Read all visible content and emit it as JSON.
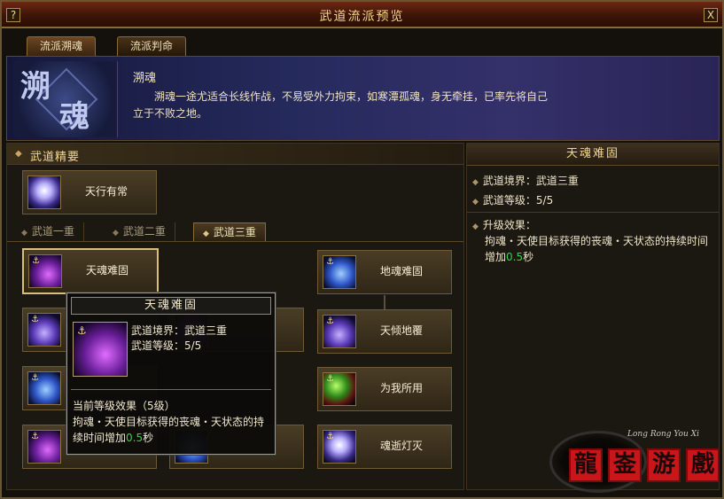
{
  "window": {
    "title": "武道流派预览",
    "help_label": "?",
    "close_label": "X"
  },
  "tabs": [
    {
      "label": "流派溯魂"
    },
    {
      "label": "流派判命"
    }
  ],
  "header": {
    "emblem_chars": [
      "溯",
      "魂"
    ],
    "name": "溯魂",
    "description": "溯魂一途尤适合长线作战，不易受外力拘束，如寒潭孤魂，身无牵挂，已率先将自己立于不败之地。"
  },
  "essence": {
    "section_title": "武道精要",
    "card_label": "天行有常"
  },
  "tiers": [
    {
      "label": "武道一重"
    },
    {
      "label": "武道二重"
    },
    {
      "label": "武道三重"
    }
  ],
  "skills": {
    "left": [
      {
        "label": "天魂难固"
      },
      {
        "label": ""
      },
      {
        "label": ""
      },
      {
        "label": ""
      }
    ],
    "right": [
      {
        "label": "地魂难固"
      },
      {
        "label": "天倾地覆"
      },
      {
        "label": "为我所用"
      },
      {
        "label": "魂逝灯灭"
      }
    ]
  },
  "tooltip": {
    "title": "天魂难固",
    "realm": "武道境界：武道三重",
    "level": "武道等级：5/5",
    "effect_head": "当前等级效果（5级）",
    "effect_text_before": "拘魂・天使目标获得的丧魂・天状态的持续时间增加",
    "effect_value": "0.5",
    "effect_text_after": "秒"
  },
  "detail": {
    "title": "天魂难固",
    "realm": "武道境界：武道三重",
    "level": "武道等级：5/5",
    "upgrade_label": "升级效果：",
    "effect_text_before": "拘魂・天使目标获得的丧魂・天状态的持续时间增加",
    "effect_value": "0.5",
    "effect_text_after": "秒"
  },
  "watermark": {
    "subtitle": "Long Rong You Xi",
    "seals": [
      "龍",
      "崟",
      "游",
      "戲"
    ]
  },
  "colors": {
    "accent_gold": "#f1d796",
    "highlight_green": "#3bd24a",
    "title_bar": "#6b2812",
    "header_band": "#252a5c"
  }
}
